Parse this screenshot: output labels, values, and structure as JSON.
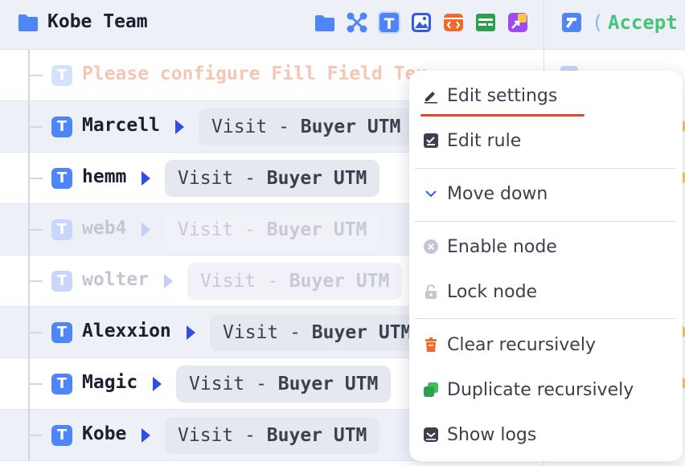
{
  "header": {
    "title": "Kobe Team",
    "paren": "(",
    "accept_label": "Accept",
    "tools": [
      "folder-icon",
      "nodes-icon",
      "text-icon",
      "image-icon",
      "code-icon",
      "table-icon",
      "export-icon"
    ]
  },
  "rows": [
    {
      "type": "warning",
      "label": "Please configure Fill Field Tex"
    },
    {
      "name": "Marcell",
      "pill_prefix": "Visit - ",
      "pill_bold": "Buyer UTM",
      "dim": false
    },
    {
      "name": "hemm",
      "pill_prefix": "Visit - ",
      "pill_bold": "Buyer UTM",
      "dim": false
    },
    {
      "name": "web4",
      "pill_prefix": "Visit - ",
      "pill_bold": "Buyer UTM",
      "dim": true
    },
    {
      "name": "wolter",
      "pill_prefix": "Visit - ",
      "pill_bold": "Buyer UTM",
      "dim": true
    },
    {
      "name": "Alexxion",
      "pill_prefix": "Visit - ",
      "pill_bold": "Buyer UTM",
      "dim": false
    },
    {
      "name": "Magic",
      "pill_prefix": "Visit - ",
      "pill_bold": "Buyer UTM",
      "dim": false
    },
    {
      "name": "Kobe",
      "pill_prefix": "Visit - ",
      "pill_bold": "Buyer UTM",
      "dim": false
    }
  ],
  "menu": {
    "items": [
      {
        "label": "Edit settings",
        "icon": "pencil-icon"
      },
      {
        "label": "Edit rule",
        "icon": "rule-icon"
      },
      {
        "label": "Move down",
        "icon": "chevron-down-icon"
      },
      {
        "label": "Enable node",
        "icon": "x-circle-icon"
      },
      {
        "label": "Lock node",
        "icon": "lock-icon"
      },
      {
        "label": "Clear recursively",
        "icon": "trash-icon"
      },
      {
        "label": "Duplicate recursively",
        "icon": "duplicate-icon"
      },
      {
        "label": "Show logs",
        "icon": "logs-icon"
      }
    ]
  },
  "colors": {
    "accent": "#4f86f7",
    "accept_green": "#46c37b",
    "highlight_red": "#e4462e"
  }
}
